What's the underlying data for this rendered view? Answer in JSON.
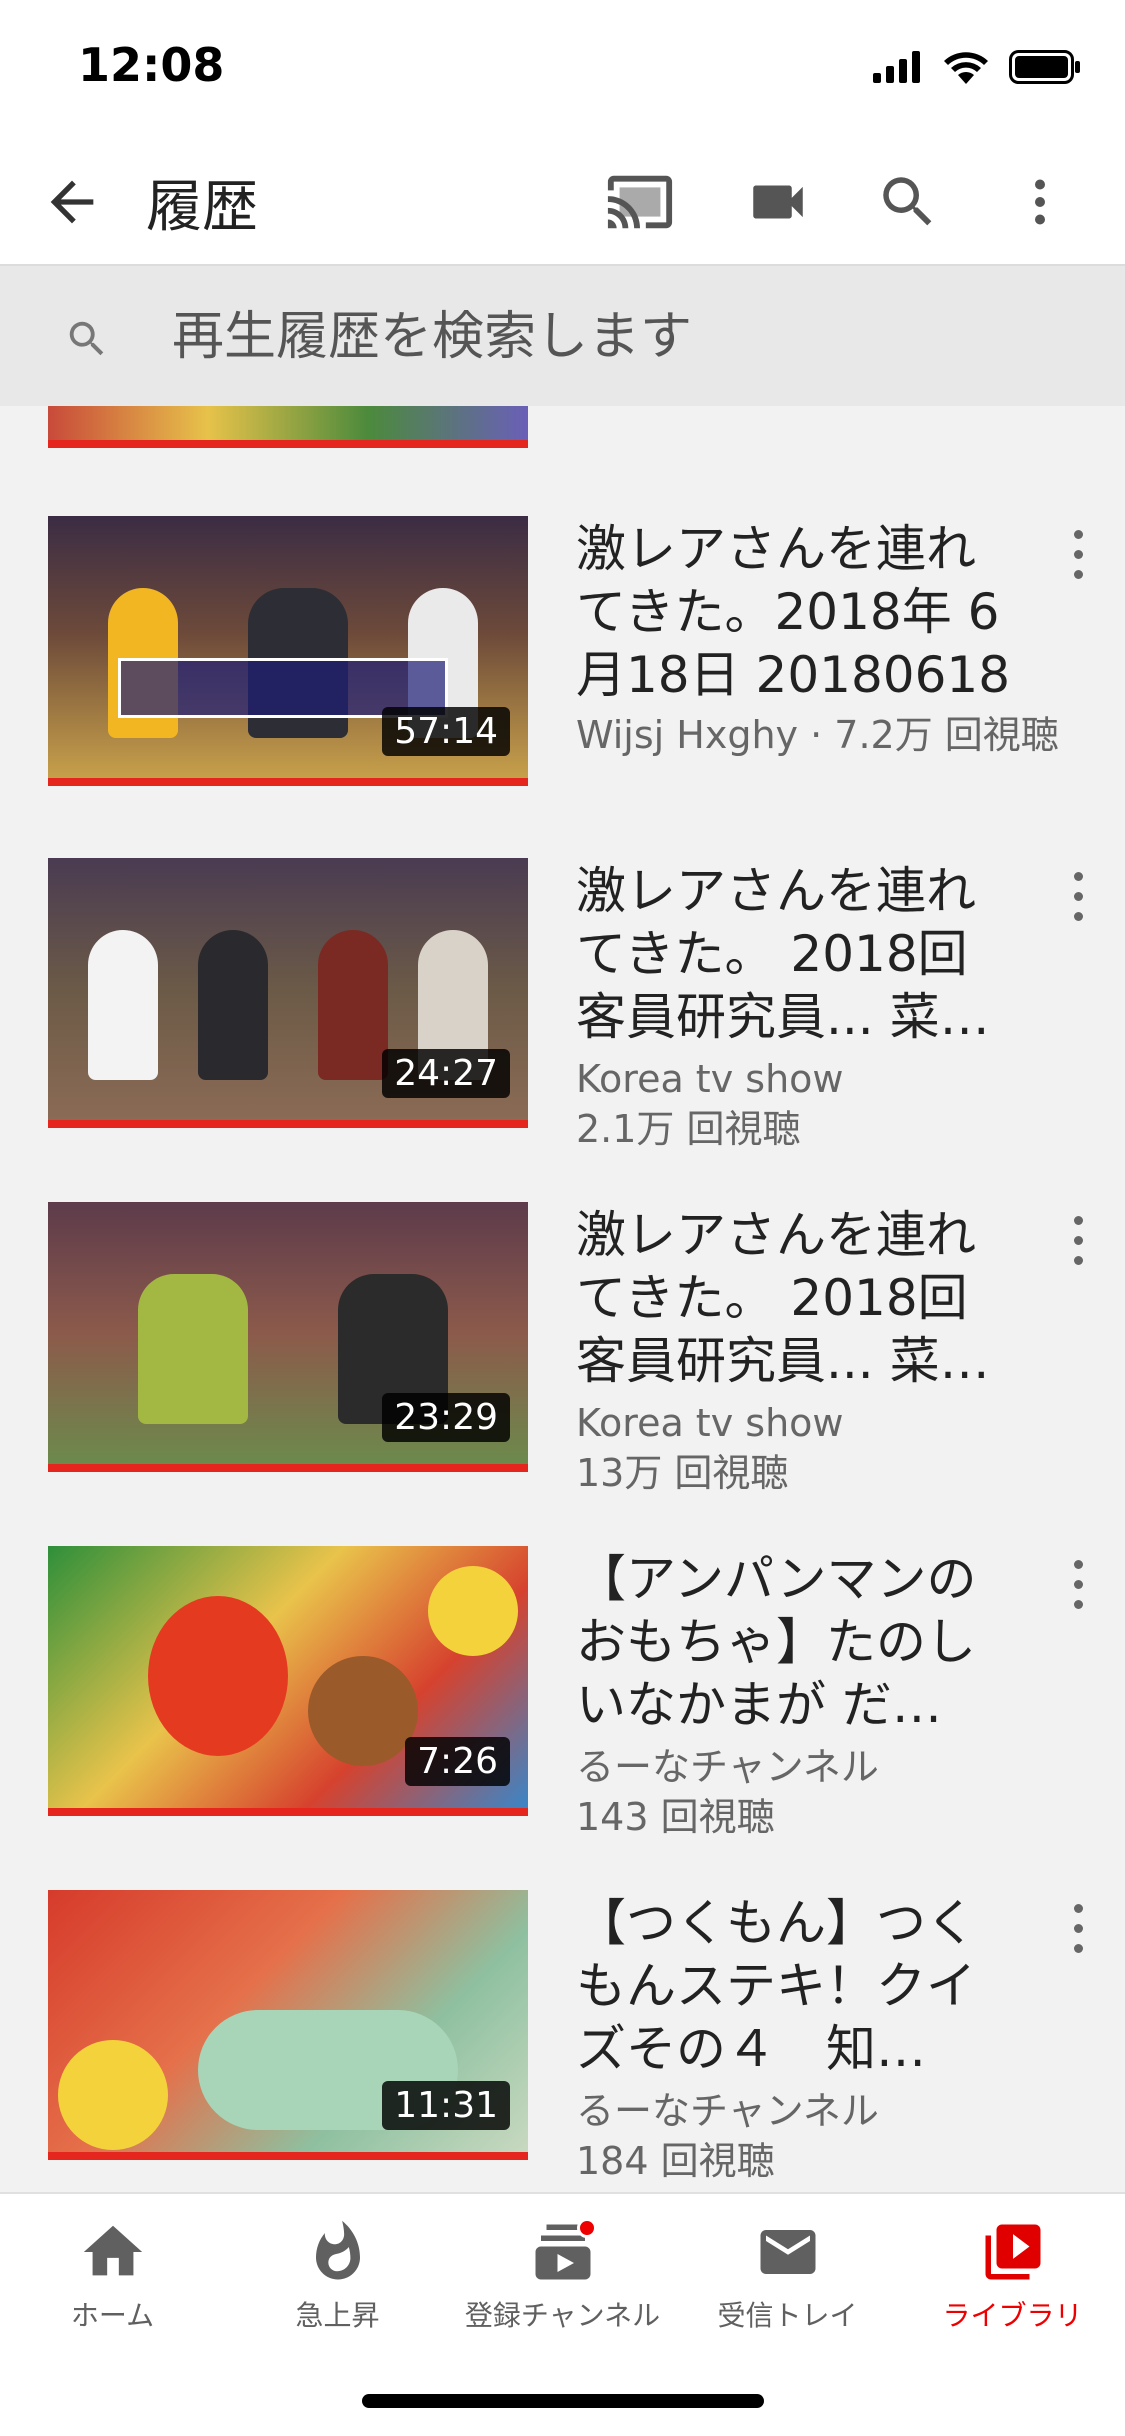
{
  "status": {
    "time": "12:08"
  },
  "app_bar": {
    "title": "履歴"
  },
  "search": {
    "placeholder": "再生履歴を検索します"
  },
  "videos": [
    {
      "title": "激レアさんを連れてきた。2018年 6月18日 20180618",
      "meta_line1": "Wijsj Hxghy · 7.2万 回視聴",
      "meta_line2": "",
      "duration": "57:14"
    },
    {
      "title": "激レアさんを連れてきた。 2018回 客員研究員... 菜…",
      "meta_line1": "Korea tv show",
      "meta_line2": "2.1万 回視聴",
      "duration": "24:27"
    },
    {
      "title": "激レアさんを連れてきた。 2018回 客員研究員... 菜…",
      "meta_line1": "Korea tv show",
      "meta_line2": "13万 回視聴",
      "duration": "23:29"
    },
    {
      "title": "【アンパンマンのおもちゃ】たのしいなかまが だ…",
      "meta_line1": "るーなチャンネル",
      "meta_line2": "143 回視聴",
      "duration": "7:26"
    },
    {
      "title": "【つくもん】つくもんステキ！クイズその４　知…",
      "meta_line1": "るーなチャンネル",
      "meta_line2": "184 回視聴",
      "duration": "11:31"
    }
  ],
  "bottom_nav": [
    {
      "label": "ホーム",
      "icon": "home-icon"
    },
    {
      "label": "急上昇",
      "icon": "trending-flame-icon"
    },
    {
      "label": "登録チャンネル",
      "icon": "subscriptions-icon"
    },
    {
      "label": "受信トレイ",
      "icon": "inbox-mail-icon"
    },
    {
      "label": "ライブラリ",
      "icon": "library-icon"
    }
  ],
  "colors": {
    "accent": "#e00000",
    "background": "#f2f2f2",
    "progress": "#e5261f"
  }
}
